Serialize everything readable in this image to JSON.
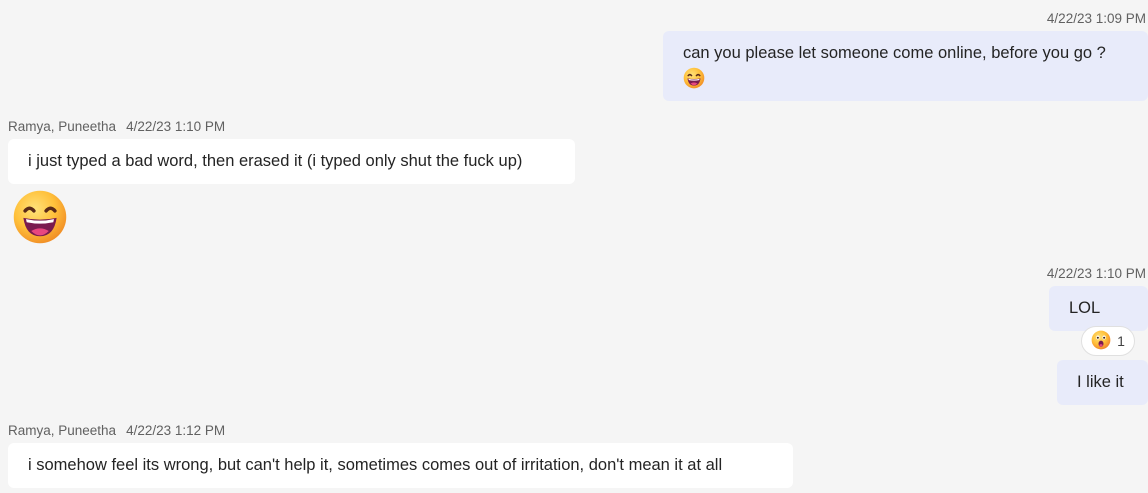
{
  "messages": [
    {
      "timestamp": "4/22/23 1:09 PM",
      "text": "can you please let someone come online, before you go ?",
      "emoji": "grinning-face-emoji"
    },
    {
      "sender": "Ramya, Puneetha",
      "timestamp": "4/22/23 1:10 PM",
      "text": "i just typed a bad word, then erased it (i typed only shut the fuck up)",
      "emoji": "grinning-face-emoji"
    },
    {
      "timestamp": "4/22/23 1:10 PM",
      "text": "LOL",
      "reaction": {
        "emoji": "surprised-face-emoji",
        "count": "1"
      }
    },
    {
      "text": "I like it"
    },
    {
      "sender": "Ramya, Puneetha",
      "timestamp": "4/22/23 1:12 PM",
      "text": "i somehow feel its wrong, but can't help it, sometimes comes out of irritation, don't mean it at all"
    }
  ],
  "colors": {
    "background": "#f5f5f5",
    "outgoing_bubble": "#e8ebfa",
    "incoming_bubble": "#ffffff",
    "meta_text": "#616161"
  }
}
